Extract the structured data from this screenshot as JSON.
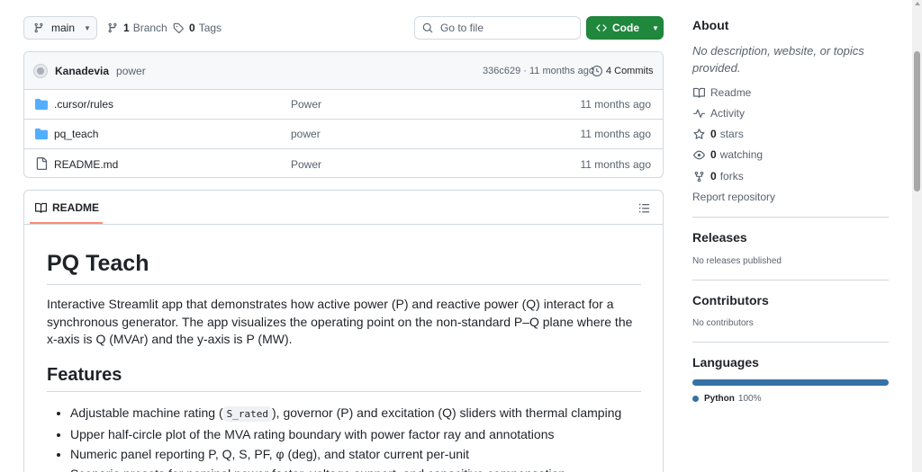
{
  "toolbar": {
    "branch_name": "main",
    "branch_count": "1",
    "branch_label": "Branch",
    "tag_count": "0",
    "tag_label": "Tags",
    "goto_placeholder": "Go to file",
    "code_label": "Code",
    "code_color": "#1f883d"
  },
  "commit": {
    "author": "Kanadevia",
    "message": "power",
    "hash_time": "336c629 · 11 months ago",
    "count": "4",
    "count_label": "Commits"
  },
  "files": [
    {
      "name": ".cursor/rules",
      "icon": "folder-icon",
      "message": "Power",
      "time": "11 months ago"
    },
    {
      "name": "pq_teach",
      "icon": "folder-icon",
      "message": "power",
      "time": "11 months ago"
    },
    {
      "name": "README.md",
      "icon": "file-icon",
      "message": "Power",
      "time": "11 months ago"
    }
  ],
  "readme": {
    "tab_label": "README",
    "title": "PQ Teach",
    "intro": "Interactive Streamlit app that demonstrates how active power (P) and reactive power (Q) interact for a synchronous generator. The app visualizes the operating point on the non-standard P–Q plane where the x-axis is Q (MVAr) and the y-axis is P (MW).",
    "features_heading": "Features",
    "feature_1_pre": "Adjustable machine rating (",
    "feature_1_code": "S_rated",
    "feature_1_post": "), governor (P) and excitation (Q) sliders with thermal clamping",
    "feature_2": "Upper half-circle plot of the MVA rating boundary with power factor ray and annotations",
    "feature_3": "Numeric panel reporting P, Q, S, PF, φ (deg), and stator current per-unit",
    "feature_4": "Scenario presets for nominal power factor, voltage support, and capacitive compensation"
  },
  "sidebar": {
    "about_title": "About",
    "about_desc": "No description, website, or topics provided.",
    "readme_link": "Readme",
    "activity_link": "Activity",
    "stars_count": "0",
    "stars_label": "stars",
    "watching_count": "0",
    "watching_label": "watching",
    "forks_count": "0",
    "forks_label": "forks",
    "report_link": "Report repository",
    "releases_title": "Releases",
    "releases_empty": "No releases published",
    "contributors_title": "Contributors",
    "contributors_empty": "No contributors",
    "languages_title": "Languages",
    "language_name": "Python",
    "language_pct": "100%",
    "language_color": "#3572A5"
  }
}
